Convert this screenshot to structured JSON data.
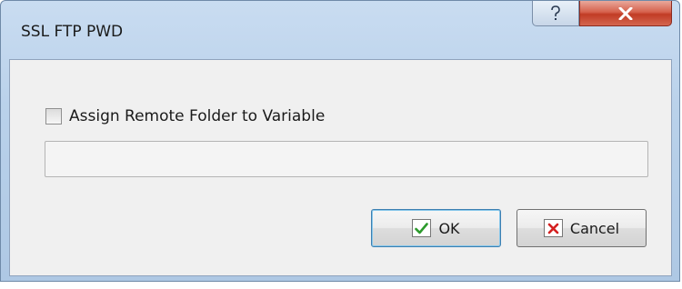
{
  "window": {
    "title": "SSL FTP PWD"
  },
  "caption_buttons": {
    "help_icon": "question-mark",
    "close_icon": "x-glyph"
  },
  "options": {
    "assign_checkbox_label": "Assign Remote Folder to Variable",
    "assign_checked": false,
    "variable_value": ""
  },
  "buttons": {
    "ok_label": "OK",
    "cancel_label": "Cancel",
    "ok_icon": "checkmark-icon",
    "cancel_icon": "red-x-icon"
  },
  "colors": {
    "ok_check": "#2c9a2c",
    "cancel_x": "#d42020",
    "close_button": "#c84a35"
  }
}
